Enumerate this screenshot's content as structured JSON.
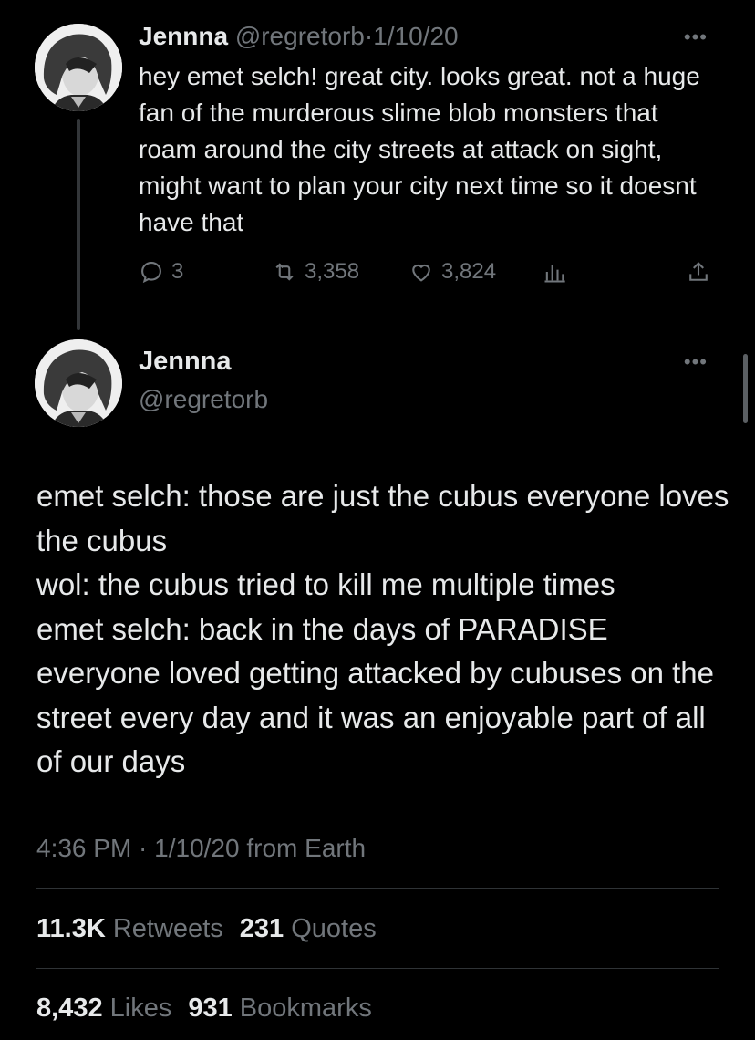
{
  "reply_tweet": {
    "display_name": "Jennna",
    "handle": "@regretorb",
    "separator": "·",
    "date": "1/10/20",
    "text": "hey emet selch! great city. looks great. not a huge fan of the murderous slime blob monsters that roam around the city streets at attack on sight, might want to plan your city next time so it doesnt have that",
    "replies": "3",
    "retweets": "3,358",
    "likes": "3,824",
    "more_icon": "ellipsis-icon"
  },
  "main_tweet": {
    "display_name": "Jennna",
    "handle": "@regretorb",
    "lines": [
      "emet selch: those are just the cubus everyone loves the cubus",
      "wol: the cubus tried to kill me multiple times",
      "emet selch: back in the days of PARADISE everyone loved getting attacked by cubuses on the street every day and it was an enjoyable part of all of our days"
    ],
    "timestamp": "4:36 PM · 1/10/20 from Earth"
  },
  "stats": {
    "retweets_count": "11.3K",
    "retweets_label": "Retweets",
    "quotes_count": "231",
    "quotes_label": "Quotes",
    "likes_count": "8,432",
    "likes_label": "Likes",
    "bookmarks_count": "931",
    "bookmarks_label": "Bookmarks"
  },
  "colors": {
    "background": "#000000",
    "text": "#e7e9ea",
    "muted": "#71767b",
    "divider": "#2f3336"
  }
}
